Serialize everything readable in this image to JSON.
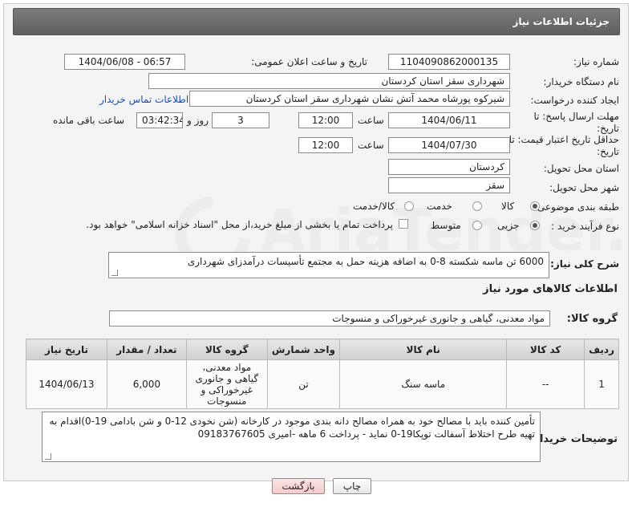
{
  "title": "جزئیات اطلاعات نیاز",
  "fields": {
    "need_number_label": "شماره نیاز:",
    "need_number": "1104090862000135",
    "announce_label": "تاریخ و ساعت اعلان عمومی:",
    "announce_value": "1404/06/08 - 06:57",
    "buyer_org_label": "نام دستگاه خریدار:",
    "buyer_org": "شهرداری سقز استان کردستان",
    "requester_label": "ایجاد کننده درخواست:",
    "requester": "شیرکوه پورشاه محمد آتش نشان شهرداری سقز استان کردستان",
    "contact_link": "اطلاعات تماس خریدار",
    "deadline_label": "مهلت ارسال پاسخ: تا تاریخ:",
    "deadline_date": "1404/06/11",
    "time_label": "ساعت",
    "deadline_time": "12:00",
    "days": "3",
    "days_label": "روز و",
    "remaining": "03:42:34",
    "remaining_label": "ساعت باقی مانده",
    "price_label": "حداقل تاریخ اعتبار قیمت: تا تاریخ:",
    "price_date": "1404/07/30",
    "price_time": "12:00",
    "province_label": "استان محل تحویل:",
    "province": "کردستان",
    "city_label": "شهر محل تحویل:",
    "city": "سقز",
    "category_label": "طبقه بندی موضوعی:",
    "cat_goods": "کالا",
    "cat_service": "خدمت",
    "cat_both": "کالا/خدمت",
    "process_label": "نوع فرآیند خرید :",
    "proc_partial": "جزیی",
    "proc_medium": "متوسط",
    "payment_note": "پرداخت تمام یا بخشی از مبلغ خرید،از محل \"اسناد خزانه اسلامی\" خواهد بود.",
    "general_desc_label": "شرح کلی نیاز:",
    "general_desc": "6000 تن ماسه شکسته 8-0 به اضافه هزینه حمل به مجتمع تأسیسات درآمدزای شهرداری"
  },
  "goods_section": {
    "heading": "اطلاعات کالاهای مورد نیاز",
    "group_label": "گروه کالا:",
    "group_value": "مواد معدنی، گیاهی و جانوری غیرخوراکی و منسوجات"
  },
  "table": {
    "headers": [
      "ردیف",
      "کد کالا",
      "نام کالا",
      "واحد شمارش",
      "گروه کالا",
      "تعداد / مقدار",
      "تاریخ نیاز"
    ],
    "rows": [
      [
        "1",
        "--",
        "ماسه سنگ",
        "تن",
        "مواد معدنی، گیاهی و جانوری غیرخوراکی و منسوجات",
        "6,000",
        "1404/06/13"
      ]
    ]
  },
  "buyer_notes_label": "توضیحات خریدار:",
  "buyer_notes": "تأمین کننده باید با مصالح خود به همراه مصالح دانه بندی موجود در کارخانه (شن نخودی 12-0 و شن بادامی 19-0)اقدام به تهیه طرح اختلاط آسفالت توپکا19-0 نماید - پرداخت 6 ماهه -امیری 09183767605",
  "buttons": {
    "print": "چاپ",
    "back": "بازگشت"
  },
  "watermark": "AriaTender.net",
  "colors": {
    "titlebar": "#6b6b6b",
    "link": "#1a4dbb",
    "watermark": "#e6e6e6"
  }
}
